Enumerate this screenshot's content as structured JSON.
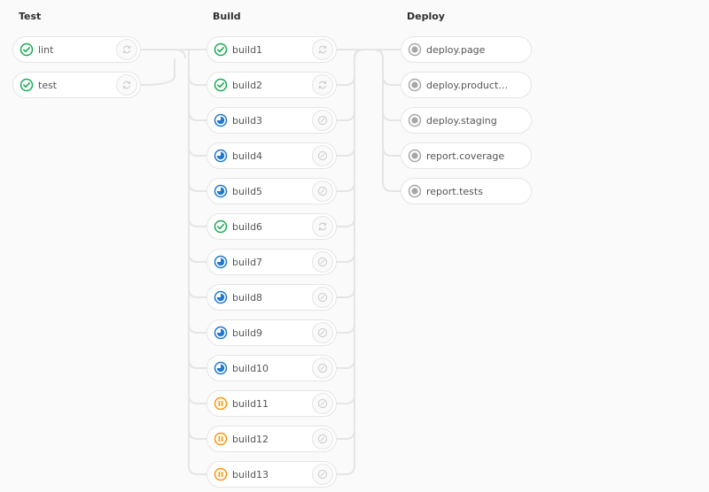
{
  "stages": [
    {
      "title": "Test",
      "jobs": [
        {
          "name": "lint",
          "status": "success",
          "action": "retry-icon"
        },
        {
          "name": "test",
          "status": "success",
          "action": "retry-icon"
        }
      ]
    },
    {
      "title": "Build",
      "jobs": [
        {
          "name": "build1",
          "status": "success",
          "action": "retry-icon"
        },
        {
          "name": "build2",
          "status": "success",
          "action": "retry-icon"
        },
        {
          "name": "build3",
          "status": "running",
          "action": "cancel-icon"
        },
        {
          "name": "build4",
          "status": "running",
          "action": "cancel-icon"
        },
        {
          "name": "build5",
          "status": "running",
          "action": "cancel-icon"
        },
        {
          "name": "build6",
          "status": "success",
          "action": "retry-icon"
        },
        {
          "name": "build7",
          "status": "running",
          "action": "cancel-icon"
        },
        {
          "name": "build8",
          "status": "running",
          "action": "cancel-icon"
        },
        {
          "name": "build9",
          "status": "running",
          "action": "cancel-icon"
        },
        {
          "name": "build10",
          "status": "running",
          "action": "cancel-icon"
        },
        {
          "name": "build11",
          "status": "paused",
          "action": "cancel-icon"
        },
        {
          "name": "build12",
          "status": "paused",
          "action": "cancel-icon"
        },
        {
          "name": "build13",
          "status": "paused",
          "action": "cancel-icon"
        }
      ]
    },
    {
      "title": "Deploy",
      "jobs": [
        {
          "name": "deploy.page",
          "status": "created"
        },
        {
          "name": "deploy.product…",
          "status": "created"
        },
        {
          "name": "deploy.staging",
          "status": "created"
        },
        {
          "name": "report.coverage",
          "status": "created"
        },
        {
          "name": "report.tests",
          "status": "created"
        }
      ]
    }
  ],
  "colors": {
    "success": "#1aaa55",
    "running": "#1f78d1",
    "paused": "#fc9403",
    "created": "#a7a7a7",
    "connector": "#e5e5e5",
    "action_icon": "#cfcfcf"
  }
}
